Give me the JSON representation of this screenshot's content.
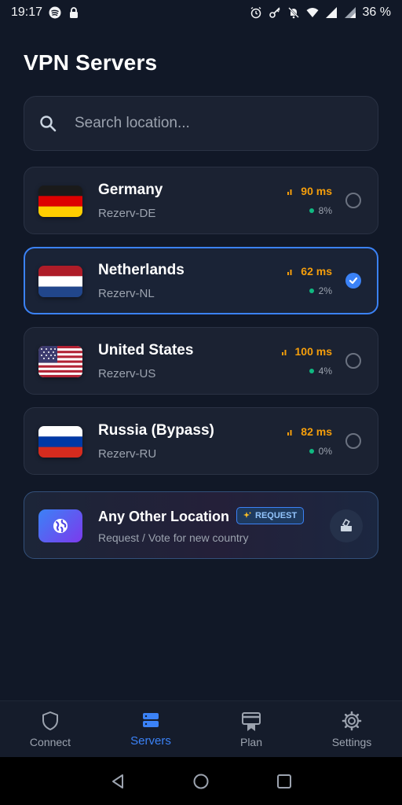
{
  "status_bar": {
    "time": "19:17",
    "battery": "36 %"
  },
  "page": {
    "title": "VPN Servers"
  },
  "search": {
    "placeholder": "Search location..."
  },
  "servers": [
    {
      "name": "Germany",
      "server": "Rezerv-DE",
      "ping": "90 ms",
      "load": "8%",
      "selected": false,
      "flag": "de"
    },
    {
      "name": "Netherlands",
      "server": "Rezerv-NL",
      "ping": "62 ms",
      "load": "2%",
      "selected": true,
      "flag": "nl"
    },
    {
      "name": "United States",
      "server": "Rezerv-US",
      "ping": "100 ms",
      "load": "4%",
      "selected": false,
      "flag": "us"
    },
    {
      "name": "Russia (Bypass)",
      "server": "Rezerv-RU",
      "ping": "82 ms",
      "load": "0%",
      "selected": false,
      "flag": "ru"
    }
  ],
  "other_location": {
    "title": "Any Other Location",
    "badge": "REQUEST",
    "subtitle": "Request / Vote for new country"
  },
  "bottom_nav": [
    {
      "label": "Connect",
      "icon": "shield-icon",
      "active": false
    },
    {
      "label": "Servers",
      "icon": "servers-icon",
      "active": true
    },
    {
      "label": "Plan",
      "icon": "plan-icon",
      "active": false
    },
    {
      "label": "Settings",
      "icon": "gear-icon",
      "active": false
    }
  ],
  "colors": {
    "accent": "#3b82f6",
    "ping": "#f59e0b",
    "load_dot": "#10b981",
    "background": "#111827"
  }
}
